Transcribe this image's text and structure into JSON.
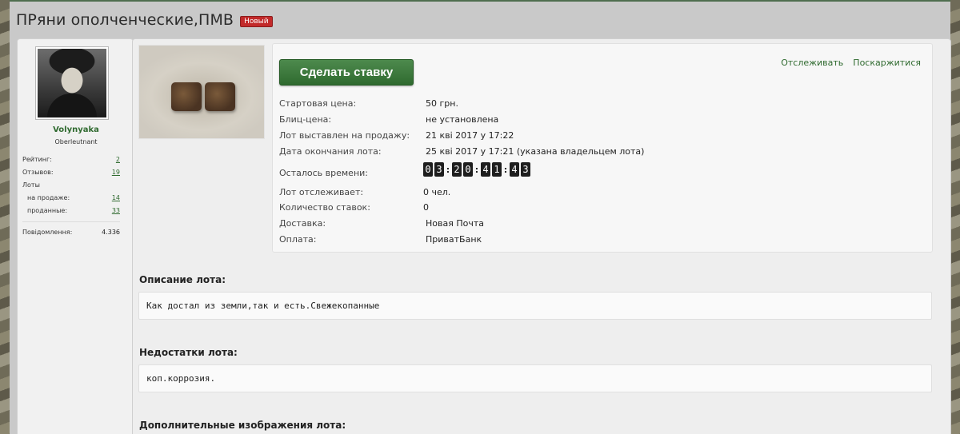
{
  "page": {
    "title": "ПРяни ополченческие,ПМВ",
    "badge": "Новый"
  },
  "user": {
    "name": "Volynyaka",
    "rank": "Oberleutnant",
    "stats": [
      {
        "label": "Рейтинг:",
        "value": "2"
      },
      {
        "label": "Отзывов:",
        "value": "19"
      },
      {
        "label": "Лоты",
        "value": ""
      },
      {
        "label": "на продаже:",
        "value": "14"
      },
      {
        "label": "проданные:",
        "value": "33"
      },
      {
        "label": "Повідомлення:",
        "value": "4.336"
      }
    ]
  },
  "lot": {
    "bid_button": "Сделать ставку",
    "links": {
      "watch": "Отслеживать",
      "complain": "Поскаржитися"
    },
    "rows": [
      {
        "label": "Стартовая цена:",
        "value": "50 грн."
      },
      {
        "label": "Блиц-цена:",
        "value": "не установлена"
      },
      {
        "label": "Лот выставлен на продажу:",
        "value": "21 кві 2017 у 17:22"
      },
      {
        "label": "Дата окончания лота:",
        "value": "25 кві 2017 у 17:21 (указана владельцем лота)"
      },
      {
        "label": "Осталось времени:",
        "value": ""
      },
      {
        "label": "Лот отслеживает:",
        "value": "0 чел."
      },
      {
        "label": "Количество ставок:",
        "value": "0"
      },
      {
        "label": "Доставка:",
        "value": "Новая Почта"
      },
      {
        "label": "Оплата:",
        "value": "ПриватБанк"
      }
    ],
    "timer": {
      "d1": "0",
      "d2": "3",
      "h1": "2",
      "h2": "0",
      "m1": "4",
      "m2": "1",
      "s1": "4",
      "s2": "3"
    }
  },
  "sections": {
    "description_title": "Описание лота:",
    "description_text": "Как достал из земли,так и есть.Свежекопанные",
    "defects_title": "Недостатки лота:",
    "defects_text": "коп.коррозия.",
    "images_title": "Дополнительные изображения лота:"
  }
}
